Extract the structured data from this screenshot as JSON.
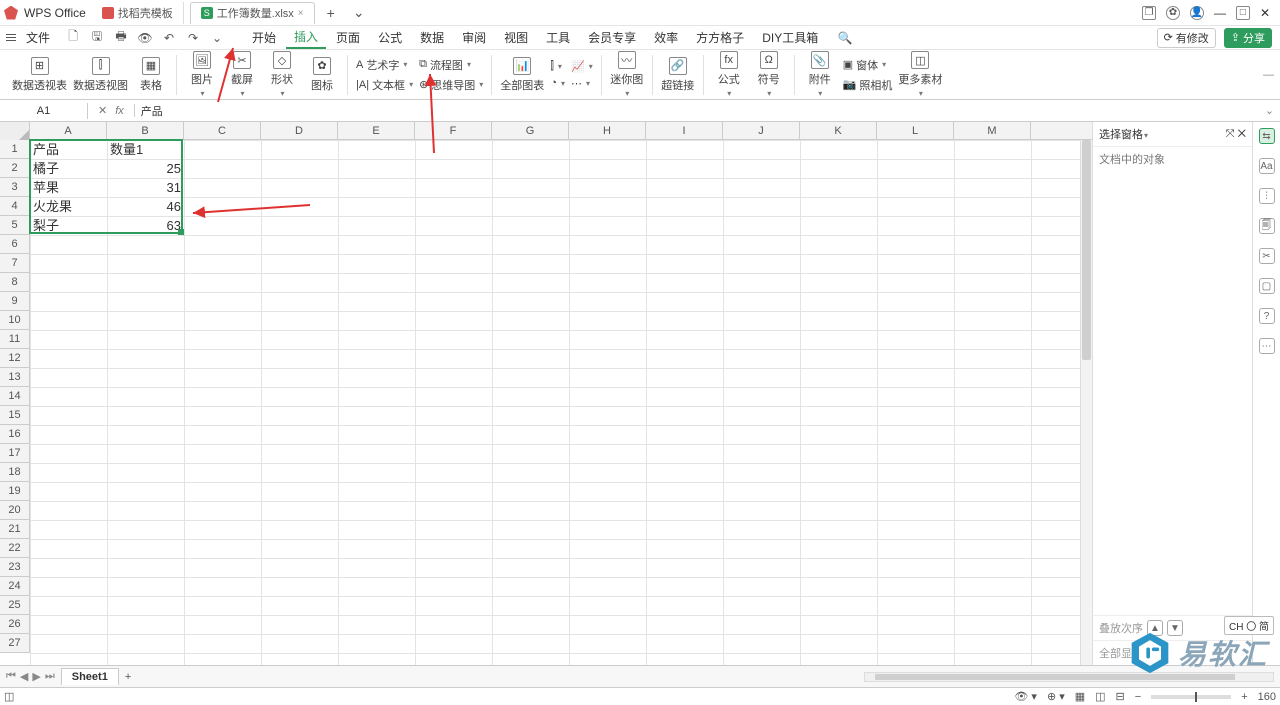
{
  "titlebar": {
    "app_name": "WPS Office",
    "tabs": [
      {
        "label": "找稻壳模板",
        "type": "red"
      },
      {
        "label": "工作簿数量.xlsx",
        "type": "green",
        "icon_letter": "S"
      }
    ],
    "add_tooltip": "+"
  },
  "menubar": {
    "file_label": "文件",
    "tabs": [
      "开始",
      "插入",
      "页面",
      "公式",
      "数据",
      "审阅",
      "视图",
      "工具",
      "会员专享",
      "效率",
      "方方格子",
      "DIY工具箱"
    ],
    "active": "插入",
    "right": {
      "modify": "有修改",
      "share": "分享"
    }
  },
  "ribbon": {
    "group1": [
      "数据透视表",
      "数据透视图",
      "表格"
    ],
    "group2": {
      "pic": "图片",
      "screen": "截屏",
      "shape": "形状",
      "icon": "图标"
    },
    "group3": {
      "art": "艺术字",
      "textbox": "文本框",
      "flow": "流程图",
      "mind": "思维导图"
    },
    "group4": {
      "all_charts": "全部图表"
    },
    "group5": {
      "spark": "迷你图"
    },
    "group6": {
      "link": "超链接"
    },
    "group7": {
      "formula": "公式",
      "symbol": "符号"
    },
    "group8": {
      "attach": "附件",
      "obj": "窗体",
      "camera": "照相机",
      "more": "更多素材"
    }
  },
  "namebar": {
    "name": "A1",
    "fx": "fx",
    "formula": "产品"
  },
  "columns": [
    "A",
    "B",
    "C",
    "D",
    "E",
    "F",
    "G",
    "H",
    "I",
    "J",
    "K",
    "L",
    "M"
  ],
  "rows_visible": 27,
  "data": {
    "A1": "产品",
    "B1": "数量1",
    "A2": "橘子",
    "B2": "25",
    "A3": "苹果",
    "B3": "31",
    "A4": "火龙果",
    "B4": "46",
    "A5": "梨子",
    "B5": "63"
  },
  "panel": {
    "title": "选择窗格",
    "body": "文档中的对象",
    "foot": "叠放次序",
    "show_all": "全部显"
  },
  "sheettabs": {
    "name": "Sheet1"
  },
  "statusbar": {
    "zoom": "160"
  },
  "ime": {
    "text": "CH 〇 简"
  },
  "watermark": "易软汇",
  "chart_data": {
    "type": "table",
    "title": "",
    "columns": [
      "产品",
      "数量1"
    ],
    "rows": [
      [
        "橘子",
        25
      ],
      [
        "苹果",
        31
      ],
      [
        "火龙果",
        46
      ],
      [
        "梨子",
        63
      ]
    ]
  }
}
